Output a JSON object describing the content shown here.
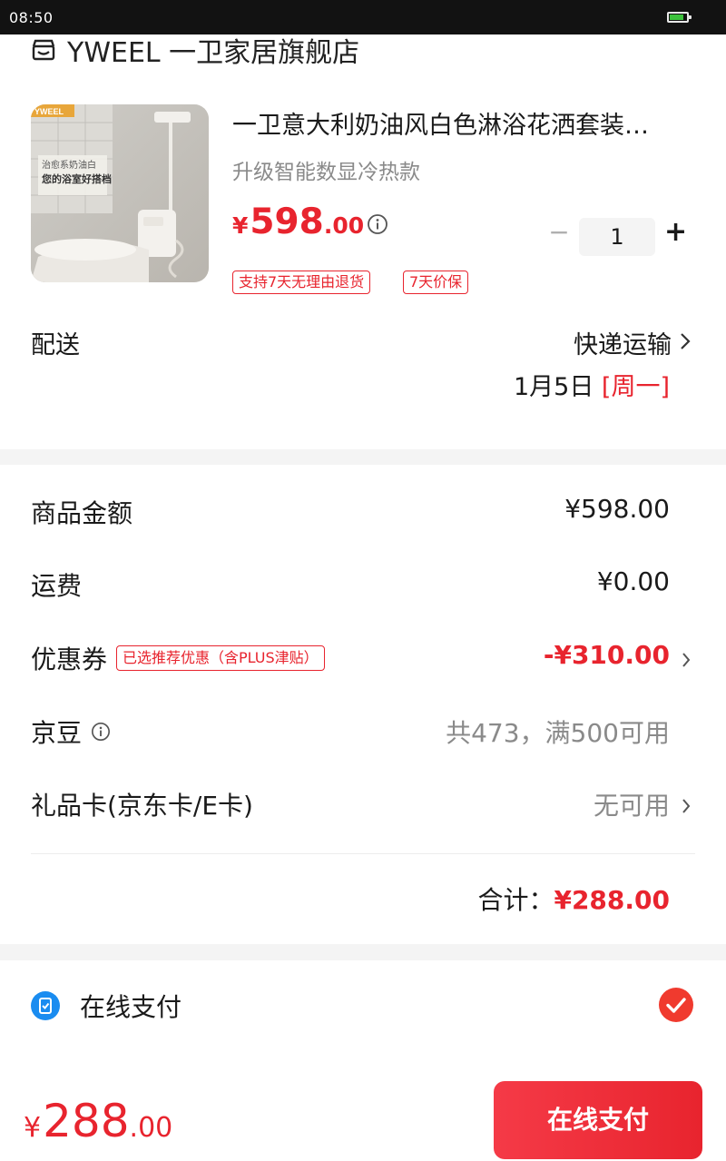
{
  "status_bar": {
    "time": "08:50",
    "battery_level": 0.85
  },
  "store": {
    "name": "YWEEL 一卫家居旗舰店"
  },
  "product": {
    "image_brand": "YWEEL",
    "image_caption_1": "治愈系奶油白",
    "image_caption_2": "您的浴室好搭档",
    "title": "一卫意大利奶油风白色淋浴花洒套装…",
    "spec": "升级智能数显冷热款",
    "price_symbol": "¥",
    "price_int": "598",
    "price_dec": ".00",
    "quantity": "1",
    "qty_minus": "−",
    "qty_plus": "+",
    "tags": [
      "支持7天无理由退货",
      "7天价保"
    ]
  },
  "delivery": {
    "label": "配送",
    "method": "快递运输",
    "date": "1月5日",
    "weekday": "[周一]"
  },
  "summary": {
    "rows": [
      {
        "label": "商品金额",
        "value": "¥598.00"
      },
      {
        "label": "运费",
        "value": "¥0.00"
      },
      {
        "label": "优惠券",
        "tag": "已选推荐优惠（含PLUS津贴）",
        "value": "-¥310.00"
      },
      {
        "label": "京豆",
        "value": "共473，满500可用"
      },
      {
        "label": "礼品卡(京东卡/E卡)",
        "value": "无可用"
      }
    ],
    "total_label": "合计：",
    "total_value": "¥288.00"
  },
  "payment": {
    "method_label": "在线支付"
  },
  "footer": {
    "price_symbol": "¥",
    "price_int": "288",
    "price_dec": ".00",
    "button_label": "在线支付"
  },
  "colors": {
    "accent": "#e8242e",
    "grey_text": "#8a8a8a",
    "pay_icon": "#1a8cf0"
  }
}
